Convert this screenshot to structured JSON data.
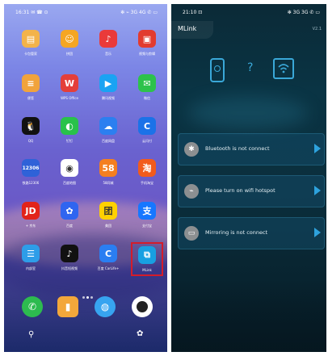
{
  "left_screen": {
    "status": {
      "time": "16:31 ✉ ☎ ⊙",
      "icons": "✻ ⌁ 3G 4G ✆ ▭"
    },
    "apps": [
      {
        "label": "卡包管家",
        "icon": "wallet-icon",
        "color": "#f3b34a",
        "glyph": "▤"
      },
      {
        "label": "拼团",
        "icon": "pintuan-icon",
        "color": "#f5a623",
        "glyph": "☺"
      },
      {
        "label": "音乐",
        "icon": "music-icon",
        "color": "#ea3a3a",
        "glyph": "♪"
      },
      {
        "label": "视频与剪辑",
        "icon": "video-edit-icon",
        "color": "#e23b2f",
        "glyph": "▣"
      },
      {
        "label": "便签",
        "icon": "notes-icon",
        "color": "#f1a33c",
        "glyph": "≡"
      },
      {
        "label": "WPS Office",
        "icon": "wps-icon",
        "color": "#e43f3a",
        "glyph": "W"
      },
      {
        "label": "腾讯视频",
        "icon": "tencent-video-icon",
        "color": "#1aa3f3",
        "glyph": "▶"
      },
      {
        "label": "微信",
        "icon": "wechat-icon",
        "color": "#2dc24b",
        "glyph": "✉"
      },
      {
        "label": "QQ",
        "icon": "qq-icon",
        "color": "#111111",
        "glyph": "🐧"
      },
      {
        "label": "钉钉",
        "icon": "dingtalk-icon",
        "color": "#29c24a",
        "glyph": "◐"
      },
      {
        "label": "百度网盘",
        "icon": "baidu-netdisk-icon",
        "color": "#2c7ff0",
        "glyph": "☁"
      },
      {
        "label": "云闪付",
        "icon": "unionpay-icon",
        "color": "#1b72e8",
        "glyph": "C"
      },
      {
        "label": "铁路12306",
        "icon": "railway-12306-icon",
        "color": "#2f62d8",
        "glyph": "12306"
      },
      {
        "label": "百度地图",
        "icon": "baidu-map-icon",
        "color": "#ffffff",
        "glyph": "◉"
      },
      {
        "label": "58同城",
        "icon": "58-icon",
        "color": "#f47f20",
        "glyph": "58"
      },
      {
        "label": "手机淘宝",
        "icon": "taobao-icon",
        "color": "#f25b1c",
        "glyph": "淘"
      },
      {
        "label": "+ 京东",
        "icon": "jd-icon",
        "color": "#e2231a",
        "glyph": "JD"
      },
      {
        "label": "百度",
        "icon": "baidu-icon",
        "color": "#2f65f0",
        "glyph": "✿"
      },
      {
        "label": "美团",
        "icon": "meituan-icon",
        "color": "#ffd100",
        "glyph": "团"
      },
      {
        "label": "支付宝",
        "icon": "alipay-icon",
        "color": "#1677ff",
        "glyph": "支"
      },
      {
        "label": "内部室",
        "icon": "chat-icon",
        "color": "#2e9de8",
        "glyph": "☰"
      },
      {
        "label": "抖音短视频",
        "icon": "douyin-icon",
        "color": "#111111",
        "glyph": "♪"
      },
      {
        "label": "百度 CarLife+",
        "icon": "carlife-icon",
        "color": "#2a7ef2",
        "glyph": "C"
      },
      {
        "label": "MLink",
        "icon": "mlink-icon",
        "color": "#18a0e2",
        "glyph": "⧉"
      }
    ],
    "dock": [
      {
        "icon": "phone-icon",
        "color": "#2dbb4f",
        "glyph": "✆"
      },
      {
        "icon": "messages-icon",
        "color": "#f3a73b",
        "glyph": "▮"
      },
      {
        "icon": "browser-icon",
        "color": "#37a4f0",
        "glyph": "◍"
      },
      {
        "icon": "camera-icon",
        "color": "#222222",
        "glyph": "●"
      }
    ]
  },
  "right_screen": {
    "status": {
      "time": "21:10 ⊡",
      "icons": "✻ 3G 3G ✆ ▭"
    },
    "app_title": "MLink",
    "version": "V2.1",
    "rows": [
      {
        "text": "Bluetooth is not connect",
        "icon": "bluetooth-icon",
        "glyph": "✱"
      },
      {
        "text": "Please turn on wifi hotspot",
        "icon": "hotspot-icon",
        "glyph": "⌁"
      },
      {
        "text": "Mirroring is not connect",
        "icon": "mirroring-icon",
        "glyph": "▭"
      }
    ]
  }
}
